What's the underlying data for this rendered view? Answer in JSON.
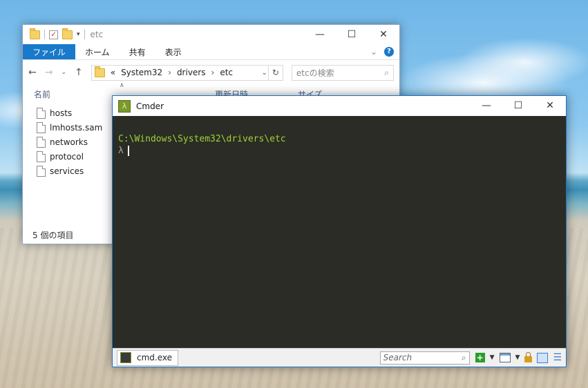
{
  "explorer": {
    "title": "etc",
    "ribbon_tabs": [
      "ファイル",
      "ホーム",
      "共有",
      "表示"
    ],
    "address": {
      "prefix": "«",
      "crumbs": [
        "System32",
        "drivers",
        "etc"
      ]
    },
    "search_placeholder": "etcの検索",
    "columns": {
      "name": "名前",
      "date": "更新日時",
      "size": "サイズ"
    },
    "files": [
      "hosts",
      "lmhosts.sam",
      "networks",
      "protocol",
      "services"
    ],
    "status": "5 個の項目"
  },
  "cmder": {
    "title": "Cmder",
    "path": "C:\\Windows\\System32\\drivers\\etc",
    "prompt": "λ",
    "tab_label": "cmd.exe",
    "search_placeholder": "Search"
  },
  "colors": {
    "explorer_accent": "#1979ca",
    "terminal_bg": "#2b2c25",
    "path_green": "#9fd23a",
    "cmder_border": "#1b73d1"
  }
}
